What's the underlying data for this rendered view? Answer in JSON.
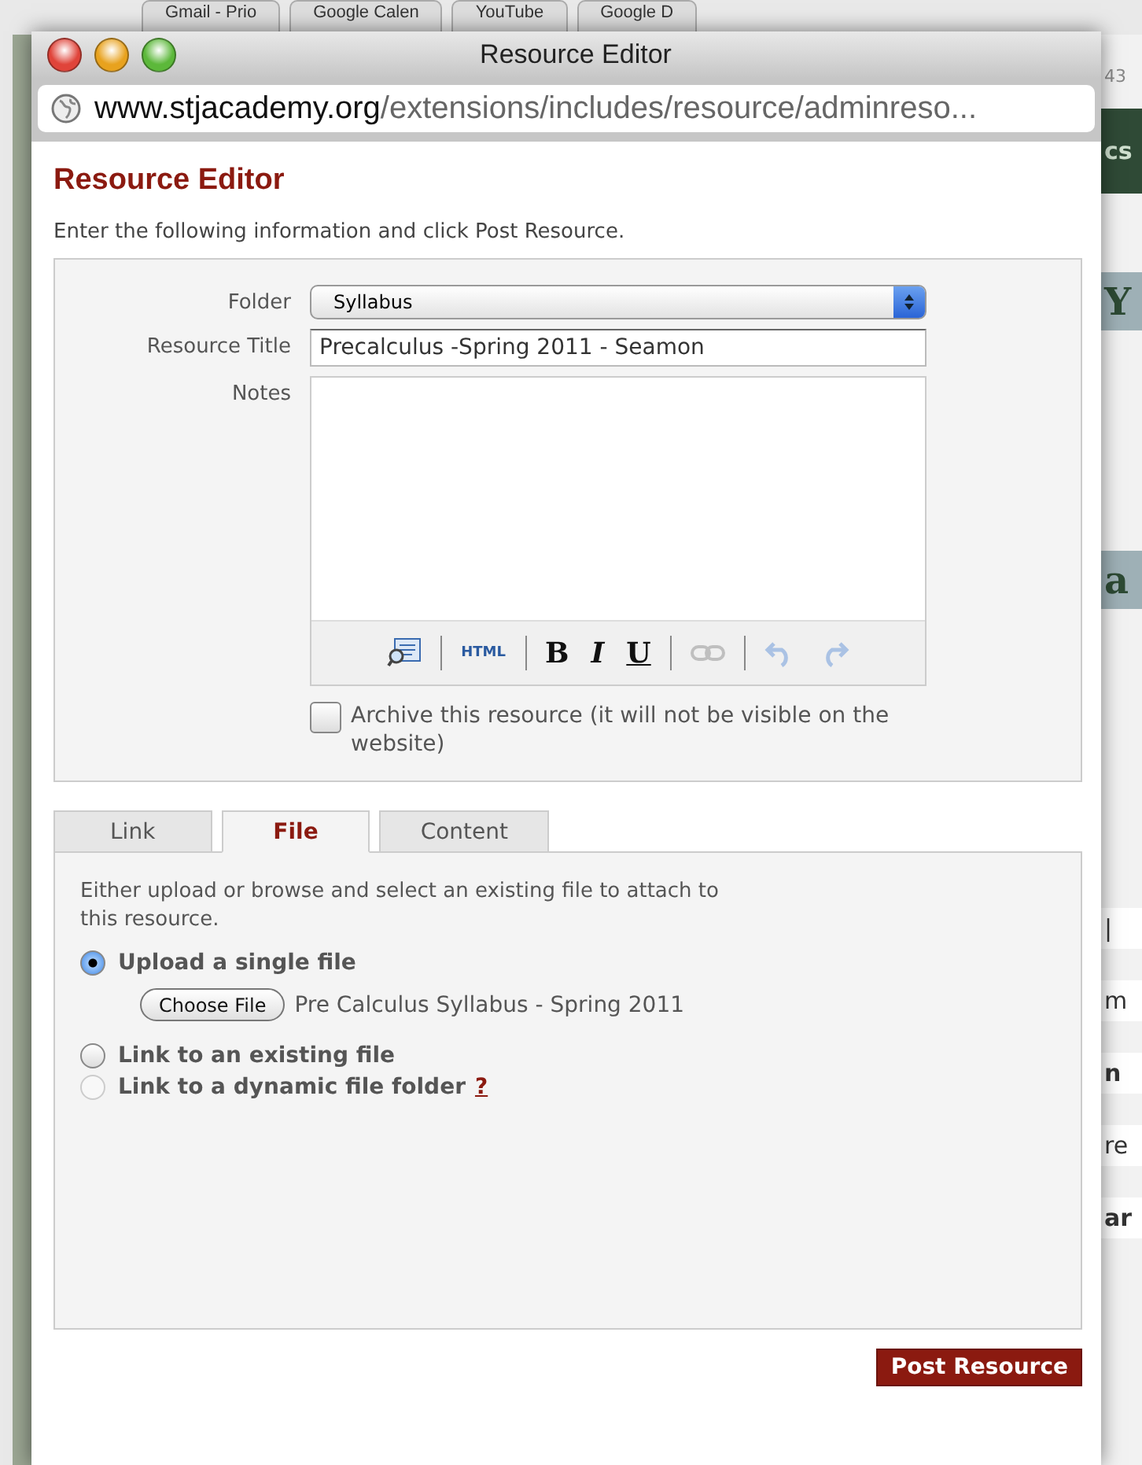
{
  "background_tabs": [
    {
      "label": "Gmail - Prio"
    },
    {
      "label": "Google Calen"
    },
    {
      "label": "YouTube"
    },
    {
      "label": "Google D"
    }
  ],
  "background_page": {
    "address_fragment": "43",
    "fragments": [
      {
        "kind": "band",
        "text": "cs"
      },
      {
        "kind": "big",
        "text": "Y"
      },
      {
        "kind": "big",
        "text": "a"
      },
      {
        "kind": "plain",
        "text": "|"
      },
      {
        "kind": "plain",
        "text": "m"
      },
      {
        "kind": "bold",
        "text": "n"
      },
      {
        "kind": "plain",
        "text": "re"
      },
      {
        "kind": "bold",
        "text": "ar"
      }
    ]
  },
  "window": {
    "title": "Resource Editor",
    "address": {
      "domain": "www.stjacademy.org",
      "path": "/extensions/includes/resource/adminreso..."
    }
  },
  "heading": "Resource Editor",
  "intro": "Enter the following information and click Post Resource.",
  "form": {
    "folder": {
      "label": "Folder",
      "value": "Syllabus"
    },
    "title": {
      "label": "Resource Title",
      "value": "Precalculus -Spring 2011 - Seamon"
    },
    "notes": {
      "label": "Notes"
    },
    "toolbar": [
      {
        "kind": "preview",
        "disabled": false
      },
      {
        "kind": "separator"
      },
      {
        "kind": "html",
        "label": "HTML",
        "disabled": false
      },
      {
        "kind": "separator"
      },
      {
        "kind": "bold",
        "label": "B",
        "disabled": false
      },
      {
        "kind": "italic",
        "label": "I",
        "disabled": false
      },
      {
        "kind": "underline",
        "label": "U",
        "disabled": false
      },
      {
        "kind": "separator"
      },
      {
        "kind": "link",
        "disabled": true
      },
      {
        "kind": "separator"
      },
      {
        "kind": "undo",
        "disabled": true
      },
      {
        "kind": "redo",
        "disabled": true
      }
    ],
    "archive": {
      "label": "Archive this resource (it will not be visible on the website)",
      "checked": false
    }
  },
  "tabs": [
    {
      "label": "Link",
      "selected": false
    },
    {
      "label": "File",
      "selected": true
    },
    {
      "label": "Content",
      "selected": false
    }
  ],
  "file_panel": {
    "description": "Either upload or browse and select an existing file to attach to this resource.",
    "options": [
      {
        "label": "Upload a single file",
        "selected": true,
        "disabled": false,
        "file": {
          "button": "Choose File",
          "name": "Pre Calculus Syllabus - Spring 2011"
        }
      },
      {
        "label": "Link to an existing file",
        "selected": false,
        "disabled": false
      },
      {
        "label": "Link to a dynamic file folder",
        "selected": false,
        "disabled": true,
        "help": "?"
      }
    ]
  },
  "submit": "Post Resource"
}
